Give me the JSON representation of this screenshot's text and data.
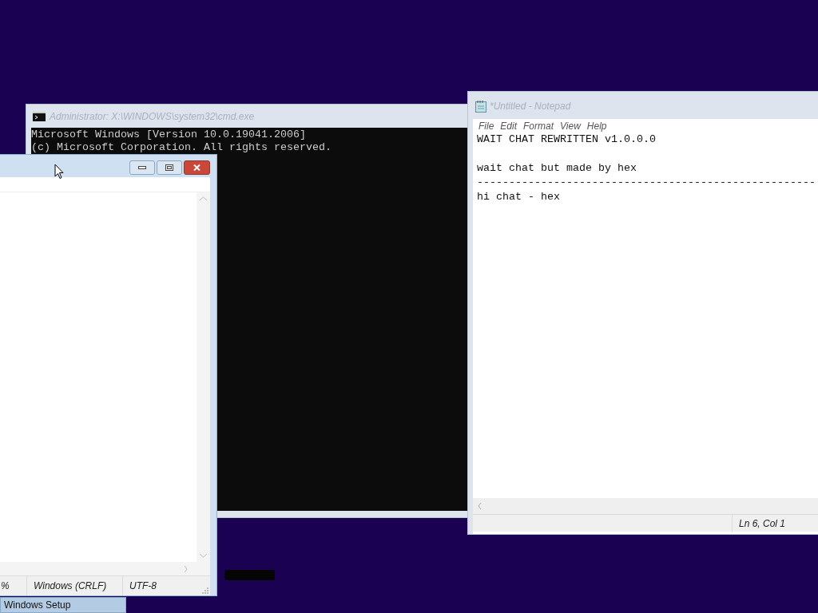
{
  "cmd_window": {
    "title": "Administrator: X:\\WINDOWS\\system32\\cmd.exe",
    "lines": [
      "Microsoft Windows [Version 10.0.19041.2006]",
      "(c) Microsoft Corporation. All rights reserved."
    ]
  },
  "notepad_window": {
    "title": "*Untitled - Notepad",
    "menu": [
      "File",
      "Edit",
      "Format",
      "View",
      "Help"
    ],
    "lines": [
      {
        "kind": "text",
        "text": "WAIT CHAT REWRITTEN v1.0.0.0"
      },
      {
        "kind": "blank"
      },
      {
        "kind": "text",
        "text": "wait chat but made by hex"
      },
      {
        "kind": "text",
        "text": "-----------------------------------------------------"
      },
      {
        "kind": "text",
        "text": "hi chat - hex"
      }
    ],
    "status": "Ln 6, Col 1"
  },
  "left_window": {
    "status": [
      "%",
      "Windows (CRLF)",
      "UTF-8"
    ]
  },
  "taskbar": [
    {
      "label": "Windows Setup"
    }
  ]
}
